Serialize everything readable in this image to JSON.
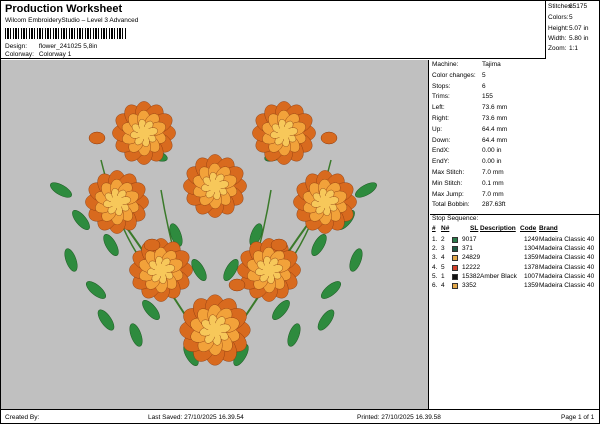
{
  "header": {
    "title": "Production Worksheet",
    "subtitle": "Wilcom EmbroideryStudio – Level 3 Advanced",
    "design_label": "Design:",
    "design_value": "flower_241025 5,8in",
    "colorway_label": "Colorway:",
    "colorway_value": "Colorway 1"
  },
  "stats": {
    "stitches_label": "Stitches:",
    "stitches_value": "65175",
    "colors_label": "Colors:",
    "colors_value": "5",
    "height_label": "Height:",
    "height_value": "5.07 in",
    "width_label": "Width:",
    "width_value": "5.80 in",
    "zoom_label": "Zoom:",
    "zoom_value": "1:1"
  },
  "machine_info": [
    {
      "k": "Machine:",
      "v": "Tajima"
    },
    {
      "k": "Color changes:",
      "v": "5"
    },
    {
      "k": "Stops:",
      "v": "6"
    },
    {
      "k": "Trims:",
      "v": "155"
    },
    {
      "k": "Left:",
      "v": "73.6 mm"
    },
    {
      "k": "Right:",
      "v": "73.6 mm"
    },
    {
      "k": "Up:",
      "v": "64.4 mm"
    },
    {
      "k": "Down:",
      "v": "64.4 mm"
    },
    {
      "k": "EndX:",
      "v": "0.00 in"
    },
    {
      "k": "EndY:",
      "v": "0.00 in"
    },
    {
      "k": "Max Stitch:",
      "v": "7.0 mm"
    },
    {
      "k": "Min Stitch:",
      "v": "0.1 mm"
    },
    {
      "k": "Max Jump:",
      "v": "7.0 mm"
    },
    {
      "k": "Total Bobbin:",
      "v": "287.63ft"
    }
  ],
  "stop_sequence": {
    "heading": "Stop Sequence:",
    "columns": {
      "num": "#",
      "n": "N#",
      "sl": "SL",
      "description": "Description",
      "code": "Code",
      "brand": "Brand"
    },
    "rows": [
      {
        "num": "1.",
        "n": "2",
        "color": "#2a7a4a",
        "sl": "9017",
        "description": "",
        "code": "1249",
        "brand": "Madeira Classic 40"
      },
      {
        "num": "2.",
        "n": "3",
        "color": "#1f5a44",
        "sl": "371",
        "description": "",
        "code": "1304",
        "brand": "Madeira Classic 40"
      },
      {
        "num": "3.",
        "n": "4",
        "color": "#e2a84a",
        "sl": "24829",
        "description": "",
        "code": "1359",
        "brand": "Madeira Classic 40"
      },
      {
        "num": "4.",
        "n": "5",
        "color": "#d4402a",
        "sl": "12222",
        "description": "",
        "code": "1378",
        "brand": "Madeira Classic 40"
      },
      {
        "num": "5.",
        "n": "1",
        "color": "#111111",
        "sl": "15382",
        "description": "Amber Black",
        "code": "1007",
        "brand": "Madeira Classic 40"
      },
      {
        "num": "6.",
        "n": "4",
        "color": "#e2a84a",
        "sl": "3352",
        "description": "",
        "code": "1359",
        "brand": "Madeira Classic 40"
      }
    ]
  },
  "footer": {
    "created_by": "Created By:",
    "last_saved": "Last Saved: 27/10/2025 16.39.54",
    "printed": "Printed: 27/10/2025 16.39.58",
    "page": "Page 1 of 1"
  },
  "colors": {
    "design_bg": "#c0c0c0",
    "petal_outer": "#d86a1e",
    "petal_inner": "#f2a23a",
    "petal_center": "#f7c85a",
    "leaf": "#2e8b3e",
    "leaf_light": "#6cc25a",
    "stem": "#3a7a2a"
  },
  "icons": {
    "design": "embroidery-heart-marigold-illustration"
  }
}
